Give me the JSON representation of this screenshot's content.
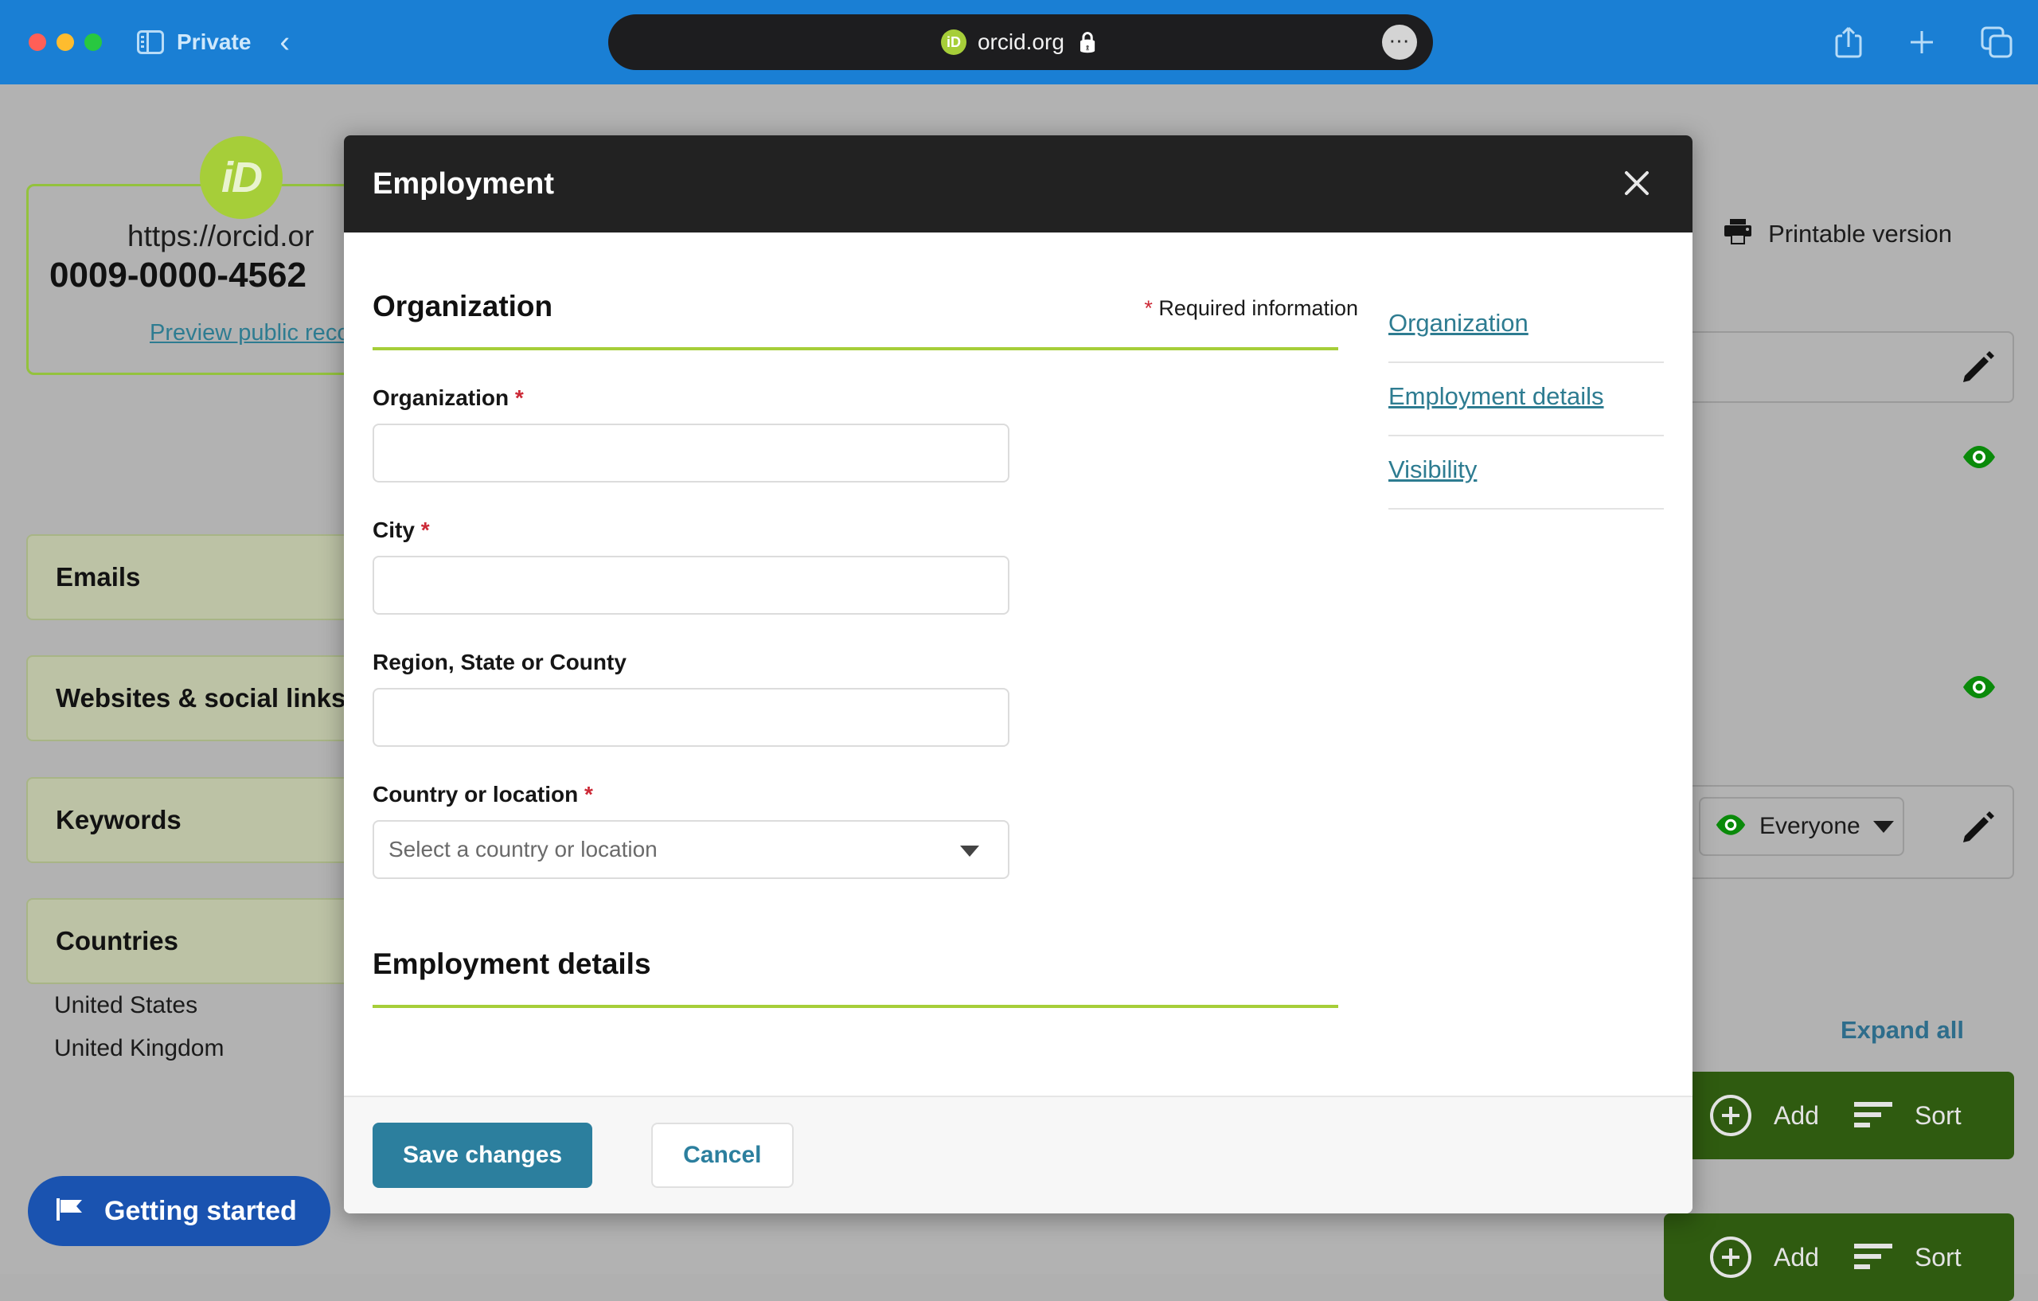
{
  "browser": {
    "private_label": "Private",
    "url": "orcid.org",
    "back_icon": "back-chevron-icon",
    "sidebar_icon": "sidebar-toggle-icon",
    "lock_icon": "lock-icon",
    "more_icon": "more-options-icon",
    "share_icon": "share-icon",
    "new_tab_icon": "plus-icon",
    "tabs_icon": "tab-overview-icon"
  },
  "record": {
    "orcid_url": "https://orcid.or",
    "orcid_id": "0009-0000-4562",
    "preview_link": "Preview public recor",
    "badge_text": "iD"
  },
  "sidebar_panels": [
    {
      "title": "Emails"
    },
    {
      "title": "Websites & social links"
    },
    {
      "title": "Keywords"
    },
    {
      "title": "Countries"
    }
  ],
  "countries": [
    "United States",
    "United Kingdom"
  ],
  "right_rail": {
    "printable_version": "Printable version",
    "printer_icon": "printer-icon",
    "expand_all": "Expand all",
    "visibility_value": "Everyone",
    "eye_icon": "eye-icon",
    "pencil_icon": "pencil-edit-icon",
    "add_label": "Add",
    "sort_label": "Sort",
    "add_icon": "plus-circle-icon",
    "sort_icon": "sort-icon"
  },
  "getting_started": {
    "label": "Getting started",
    "icon": "flag-icon"
  },
  "modal": {
    "title": "Employment",
    "close_icon": "close-icon",
    "required_note": "Required information",
    "required_star": "*",
    "sections": {
      "organization_title": "Organization",
      "employment_details_title": "Employment details"
    },
    "fields": [
      {
        "label": "Organization",
        "required": true,
        "value": "",
        "placeholder": ""
      },
      {
        "label": "City",
        "required": true,
        "value": "",
        "placeholder": ""
      },
      {
        "label": "Region, State or County",
        "required": false,
        "value": "",
        "placeholder": ""
      },
      {
        "label": "Country or location",
        "required": true,
        "value": "",
        "placeholder": "Select a country or location"
      }
    ],
    "nav": [
      {
        "label": "Organization"
      },
      {
        "label": "Employment details"
      },
      {
        "label": "Visibility"
      }
    ],
    "footer": {
      "save_label": "Save changes",
      "cancel_label": "Cancel"
    }
  },
  "colors": {
    "orcid_green": "#a6ce39",
    "teal_link": "#2e7c91",
    "dark_green_button": "#2f5b10",
    "save_blue": "#2c7f9e",
    "required_red": "#cc2936",
    "browser_blue": "#1a7fd4"
  }
}
